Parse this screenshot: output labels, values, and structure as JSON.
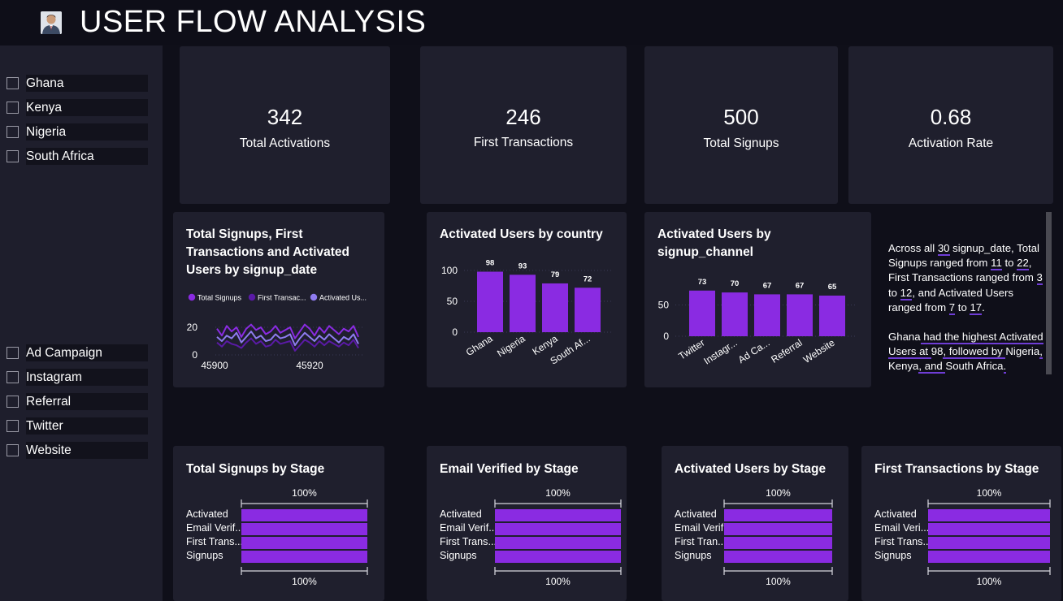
{
  "header": {
    "title": "USER FLOW ANALYSIS",
    "avatar_icon": "user-avatar-icon"
  },
  "country_slicer": {
    "items": [
      "Ghana",
      "Kenya",
      "Nigeria",
      "South Africa"
    ]
  },
  "channel_slicer": {
    "items": [
      "Ad Campaign",
      "Instagram",
      "Referral",
      "Twitter",
      "Website"
    ]
  },
  "kpis": [
    {
      "value": "342",
      "label": "Total Activations"
    },
    {
      "value": "246",
      "label": "First Transactions"
    },
    {
      "value": "500",
      "label": "Total Signups"
    },
    {
      "value": "0.68",
      "label": "Activation Rate"
    }
  ],
  "colors": {
    "bar": "#8a2be2",
    "signups": "#8a2be2",
    "first_tx": "#5a1aa6",
    "activated": "#8f7cf0",
    "background": "#0f0f19",
    "card": "#1f1f2d"
  },
  "line_chart": {
    "title": "Total Signups, First Transactions and Activated Users by signup_date",
    "legend": [
      "Total Signups",
      "First Transac...",
      "Activated Us..."
    ],
    "y_ticks": [
      "20",
      "0"
    ],
    "x_ticks": [
      "45900",
      "45920"
    ]
  },
  "country_chart": {
    "title": "Activated Users by country",
    "y_ticks": [
      "100",
      "50",
      "0"
    ],
    "categories": [
      "Ghana",
      "Nigeria",
      "Kenya",
      "South Af..."
    ],
    "values": [
      "98",
      "93",
      "79",
      "72"
    ]
  },
  "channel_chart": {
    "title": "Activated Users by signup_channel",
    "y_ticks": [
      "50",
      "0"
    ],
    "categories": [
      "Twitter",
      "Instagr...",
      "Ad Ca...",
      "Referral",
      "Website"
    ],
    "values": [
      "73",
      "70",
      "67",
      "67",
      "65"
    ]
  },
  "narrative": {
    "p1": [
      "Across all ",
      "30",
      " signup_date, Total Signups ranged from ",
      "11",
      " to ",
      "22",
      ", First Transactions ranged from ",
      "3",
      " to ",
      "12",
      ", and Activated Users ranged from ",
      "7",
      " to ",
      "17",
      "."
    ],
    "p2": [
      "Ghana",
      " had the highest Activated Users at ",
      "98",
      ", followed by ",
      "Nigeria",
      ", ",
      "Kenya",
      ", and ",
      "South Africa",
      "."
    ]
  },
  "funnels": [
    {
      "title": "Total Signups by Stage",
      "top_pct": "100%",
      "bottom_pct": "100%",
      "stages": [
        "Activated",
        "Email Verif...",
        "First Trans...",
        "Signups"
      ]
    },
    {
      "title": "Email Verified by Stage",
      "top_pct": "100%",
      "bottom_pct": "100%",
      "stages": [
        "Activated",
        "Email Verif...",
        "First Trans...",
        "Signups"
      ]
    },
    {
      "title": "Activated Users by Stage",
      "top_pct": "100%",
      "bottom_pct": "100%",
      "stages": [
        "Activated",
        "Email Verif...",
        "First Tran...",
        "Signups"
      ]
    },
    {
      "title": "First Transactions by Stage",
      "top_pct": "100%",
      "bottom_pct": "100%",
      "stages": [
        "Activated",
        "Email Veri...",
        "First Trans...",
        "Signups"
      ]
    }
  ],
  "chart_data": [
    {
      "type": "line",
      "title": "Total Signups, First Transactions and Activated Users by signup_date",
      "x_ticks": [
        45900,
        45920
      ],
      "ylim": [
        0,
        25
      ],
      "series": [
        {
          "name": "Total Signups",
          "values": [
            19,
            14,
            21,
            17,
            20,
            13,
            19,
            22,
            18,
            20,
            15,
            17,
            21,
            16,
            18,
            20,
            12,
            17,
            22,
            19,
            14,
            20,
            16,
            21,
            18,
            15,
            19,
            17,
            21,
            13
          ]
        },
        {
          "name": "First Transac...",
          "values": [
            9,
            6,
            10,
            8,
            7,
            5,
            9,
            12,
            8,
            10,
            6,
            7,
            11,
            8,
            9,
            10,
            3,
            7,
            11,
            9,
            6,
            10,
            7,
            10,
            8,
            6,
            9,
            7,
            11,
            5
          ]
        },
        {
          "name": "Activated Us...",
          "values": [
            13,
            10,
            14,
            12,
            16,
            9,
            13,
            17,
            12,
            14,
            10,
            11,
            15,
            12,
            13,
            15,
            7,
            12,
            16,
            13,
            10,
            14,
            11,
            15,
            12,
            9,
            13,
            11,
            15,
            8
          ]
        }
      ]
    },
    {
      "type": "bar",
      "title": "Activated Users by country",
      "categories": [
        "Ghana",
        "Nigeria",
        "Kenya",
        "South Africa"
      ],
      "values": [
        98,
        93,
        79,
        72
      ],
      "ylim": [
        0,
        100
      ]
    },
    {
      "type": "bar",
      "title": "Activated Users by signup_channel",
      "categories": [
        "Twitter",
        "Instagram",
        "Ad Campaign",
        "Referral",
        "Website"
      ],
      "values": [
        73,
        70,
        67,
        67,
        65
      ],
      "ylim": [
        0,
        80
      ]
    },
    {
      "type": "bar",
      "title": "Total Signups by Stage",
      "categories": [
        "Activated",
        "Email Verified",
        "First Transactions",
        "Signups"
      ],
      "values": [
        100,
        100,
        100,
        100
      ]
    },
    {
      "type": "bar",
      "title": "Email Verified by Stage",
      "categories": [
        "Activated",
        "Email Verified",
        "First Transactions",
        "Signups"
      ],
      "values": [
        100,
        100,
        100,
        100
      ]
    },
    {
      "type": "bar",
      "title": "Activated Users by Stage",
      "categories": [
        "Activated",
        "Email Verified",
        "First Transactions",
        "Signups"
      ],
      "values": [
        100,
        100,
        100,
        100
      ]
    },
    {
      "type": "bar",
      "title": "First Transactions by Stage",
      "categories": [
        "Activated",
        "Email Verified",
        "First Transactions",
        "Signups"
      ],
      "values": [
        100,
        100,
        100,
        100
      ]
    }
  ]
}
